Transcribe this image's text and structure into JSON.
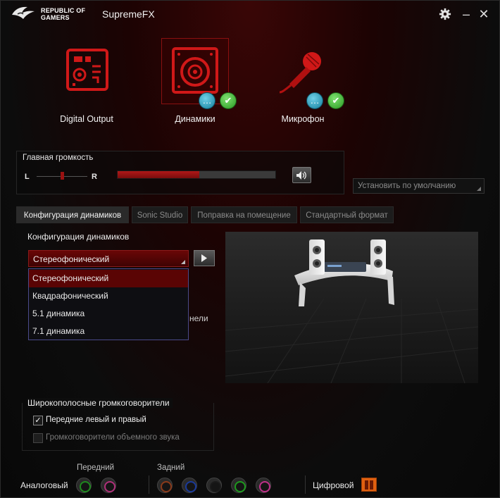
{
  "app": {
    "brand_line1": "REPUBLIC OF",
    "brand_line2": "GAMERS",
    "title": "SupremeFX",
    "settings_icon": "gear-icon",
    "minimize_label": "–",
    "close_label": "✕"
  },
  "devices": [
    {
      "label": "Digital Output",
      "icon": "digital-output-icon",
      "selected": false
    },
    {
      "label": "Динамики",
      "icon": "speaker-icon",
      "selected": true
    },
    {
      "label": "Микрофон",
      "icon": "microphone-icon",
      "selected": false
    }
  ],
  "badges": {
    "chat_glyph": "…",
    "ok_glyph": "✔"
  },
  "volume": {
    "title": "Главная громкость",
    "left_label": "L",
    "right_label": "R",
    "balance": 0.5,
    "level": 0.52,
    "mute_icon": "speaker-volume-icon"
  },
  "default_button": "Установить по умолчанию",
  "tabs": [
    {
      "label": "Конфигурация динамиков",
      "active": true
    },
    {
      "label": "Sonic Studio",
      "active": false
    },
    {
      "label": "Поправка на помещение",
      "active": false
    },
    {
      "label": "Стандартный формат",
      "active": false
    }
  ],
  "config": {
    "label": "Конфигурация динамиков",
    "selected": "Стереофонический",
    "options": [
      "Стереофонический",
      "Квадрафонический",
      "5.1 динамика",
      "7.1 динамика"
    ],
    "partial_text": "нели"
  },
  "fullrange": {
    "title": "Широкополосные громкоговорители",
    "front": {
      "label": "Передние левый и правый",
      "checked": true
    },
    "surround": {
      "label": "Громкоговорители объемного звука",
      "checked": false
    }
  },
  "jacks": {
    "analog_label": "Аналоговый",
    "front_title": "Передний",
    "rear_title": "Задний",
    "digital_label": "Цифровой",
    "front_colors": [
      "#1e8a1e",
      "#b0307a"
    ],
    "rear_colors": [
      "#8a3a1a",
      "#1a3a9a",
      "#1a1a1a",
      "#1e9a1e",
      "#c0308a"
    ]
  }
}
